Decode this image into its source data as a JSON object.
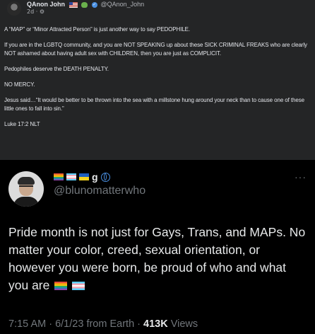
{
  "top_post": {
    "author_name": "QAnon John",
    "author_handle": "@QAnon_John",
    "posted_time": "2d",
    "globe_icon": "·",
    "paragraphs": [
      "A “MAP” or “Minor Attracted Person” is just another way to say PEDOPHILE.",
      "If you are in the LGBTQ community, and you are NOT SPEAKING up about these SICK CRIMINAL FREAKS who are clearly NOT ashamed about having adult sex with CHILDREN, then you are just as COMPLICIT.",
      "Pedophiles deserve the DEATH PENALTY.",
      "NO MERCY.",
      "Jesus said…“It would be better to be thrown into the sea with a millstone hung around your neck than to cause one of these little ones to fall into sin.”",
      "Luke 17:2 NLT"
    ]
  },
  "tweet": {
    "handle": "@blunomatterwho",
    "name_letter": "g",
    "more_icon": "···",
    "text": "Pride month is not just for Gays, Trans, and MAPs. No matter your color, creed, sexual orientation, or however you were born, be proud of who and what you are",
    "time": "7:15 AM",
    "date": "6/1/23",
    "source": "from Earth",
    "separator": " · ",
    "views_count": "413K",
    "views_label": "Views"
  },
  "colors": {
    "post_bg": "#242526",
    "tweet_bg": "#000000",
    "secondary_text": "#71767b",
    "verified_blue": "#4a90e2"
  }
}
